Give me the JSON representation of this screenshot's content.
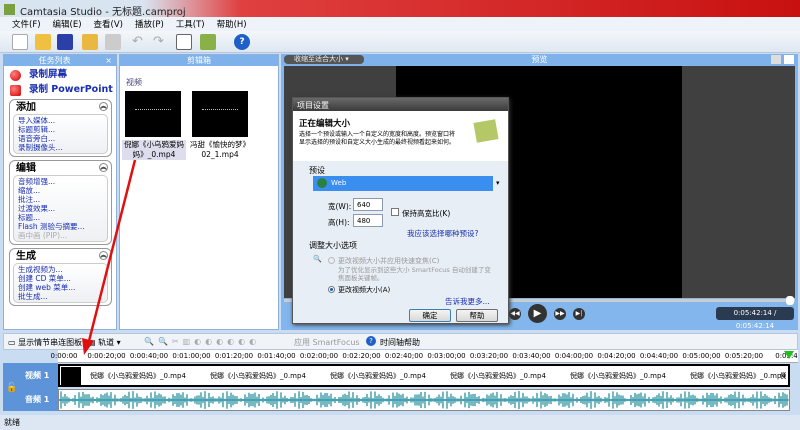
{
  "window": {
    "title": "Camtasia Studio - 无标题.camproj"
  },
  "menu": [
    "文件(F)",
    "编辑(E)",
    "查看(V)",
    "播放(P)",
    "工具(T)",
    "帮助(H)"
  ],
  "task_panel": {
    "title": "任务列表",
    "close": "×",
    "record_screen": "录制屏幕",
    "record_ppt": "录制 PowerPoint",
    "groups": [
      {
        "title": "添加",
        "items": [
          "导入媒体...",
          "标题剪辑...",
          "语音旁白...",
          "录制摄像头..."
        ]
      },
      {
        "title": "编辑",
        "items": [
          "音频增强...",
          "缩放...",
          "批注...",
          "过渡效果...",
          "标题...",
          "Flash 测验与摘要...",
          "画中画 (PIP)..."
        ]
      },
      {
        "title": "生成",
        "items": [
          "生成视频为...",
          "创建 CD 菜单...",
          "创建 web 菜单...",
          "批生成..."
        ]
      }
    ]
  },
  "clip_bin": {
    "title": "剪辑箱",
    "section": "视频",
    "clips": [
      "倪娜《小乌鸦爱妈妈》_0.mp4",
      "冯甜《愉快的梦》02_1.mp4"
    ]
  },
  "preview": {
    "title": "预览",
    "zoom_select": "收缩至适合大小",
    "time": "0:05:42:14 / 0:05:42:14",
    "progress": 1.0
  },
  "dialog": {
    "title": "项目设置",
    "heading": "正在编辑大小",
    "description": "选择一个预设或输入一个自定义的宽度和高度。预览窗口将显示选择的预设和自定义大小生成的最终视频看起来如何。",
    "preset_label": "预设",
    "preset_value": "Web",
    "width_label": "宽(W):",
    "width": "640",
    "height_label": "高(H):",
    "height": "480",
    "keep_ratio": "保持高宽比(K)",
    "keep_ratio_checked": false,
    "which_preset_link": "我应该选择哪种预设?",
    "resize_options": "调整大小选项",
    "option1": "更改视频大小并应用快速变焦(C)",
    "option1_note": "为了优化显示到这些大小 SmartFocus 自动创建了变焦面板关键帧。",
    "option2": "更改视频大小(A)",
    "selected_option": "option2",
    "more_link": "告诉我更多...",
    "ok": "确定",
    "help": "帮助"
  },
  "timeline": {
    "storyboard": "显示情节串连图板",
    "tracks_btn": "轨道",
    "smartfocus": "应用 SmartFocus",
    "help": "时间轴帮助",
    "ticks": [
      "0:00:00",
      "0:00:20;00",
      "0:00:40;00",
      "0:01:00;00",
      "0:01:20;00",
      "0:01:40;00",
      "0:02:00;00",
      "0:02:20;00",
      "0:02:40;00",
      "0:03:00;00",
      "0:03:20;00",
      "0:03:40;00",
      "0:04:00;00",
      "0:04:20;00",
      "0:04:40;00",
      "0:05:00;00",
      "0:05:20;00",
      "0:05:4"
    ],
    "video_track": "视频 1",
    "audio_track": "音频 1",
    "clip_label": "倪娜《小乌鸦爱妈妈》_0.mp4"
  },
  "status": "就绪",
  "colors": {
    "accent": "#7fb2ea",
    "title_red": "#c81010",
    "link": "#1a2fb0"
  }
}
